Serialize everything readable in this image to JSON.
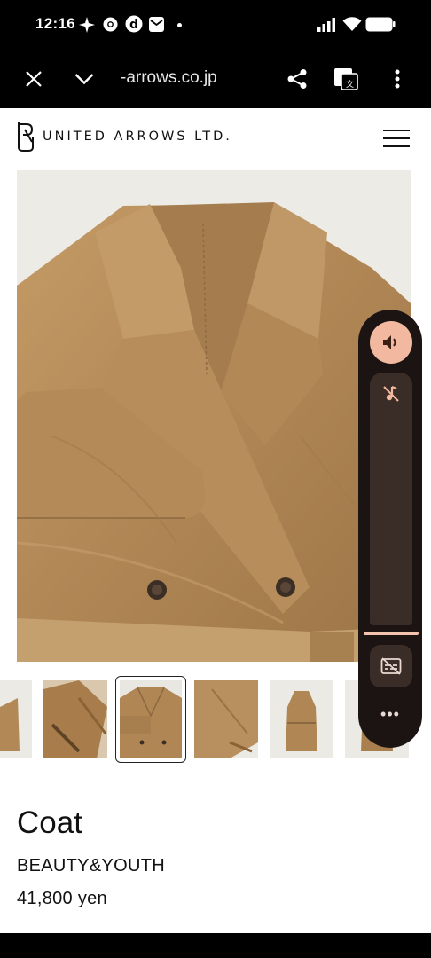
{
  "status_bar": {
    "time": "12:16",
    "icons": [
      "sparkle-icon",
      "chrome-icon",
      "d-app-icon",
      "mail-icon",
      "dot-icon",
      "signal-icon",
      "wifi-icon",
      "battery-icon"
    ]
  },
  "browser": {
    "url": "-arrows.co.jp",
    "icons": [
      "close-icon",
      "chevron-down-icon",
      "share-icon",
      "translate-icon",
      "more-vertical-icon"
    ]
  },
  "site": {
    "logo_text": "UNITED ARROWS LTD.",
    "menu_icon": "hamburger-menu-icon"
  },
  "product": {
    "name": "Coat",
    "brand": "BEAUTY&YOUTH",
    "price": "41,800 yen",
    "thumbnails_count": 6,
    "selected_thumbnail": 3
  },
  "volume_panel": {
    "icons": [
      "speaker-icon",
      "mute-notification-icon",
      "captions-off-icon",
      "more-horizontal-icon"
    ],
    "more_label": "•••",
    "level": 0
  },
  "colors": {
    "coat": "#b08a5a",
    "panel_bg": "#1c1412",
    "panel_accent": "#f2b9a0"
  }
}
